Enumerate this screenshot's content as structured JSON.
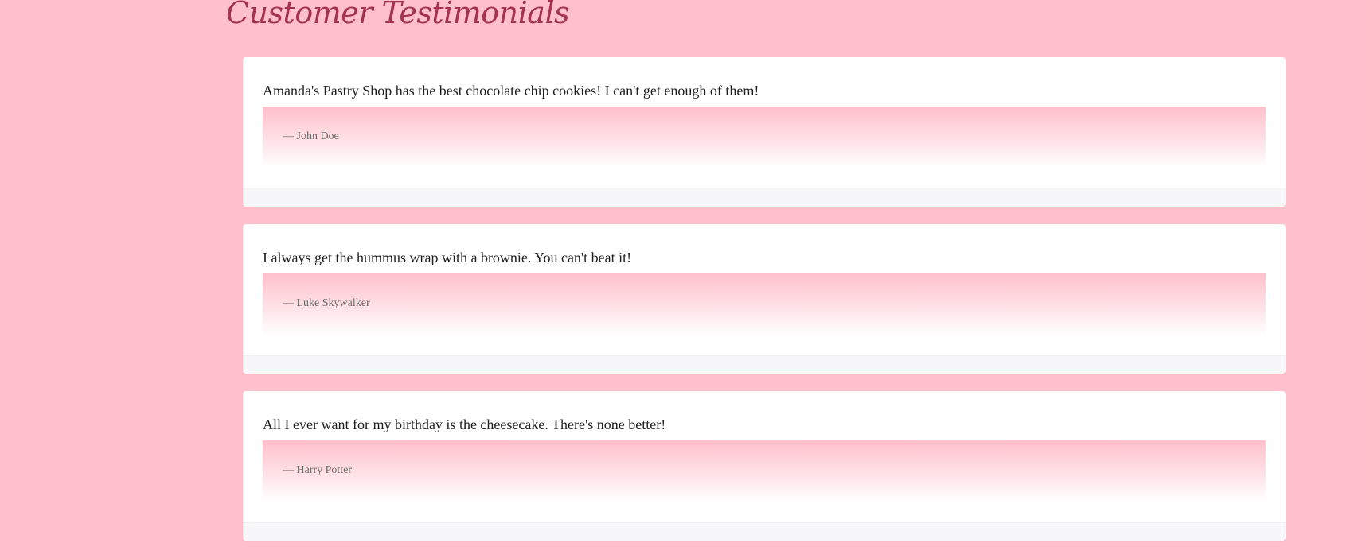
{
  "page": {
    "title": "Customer Testimonials"
  },
  "colors": {
    "background": "#ffc0cb",
    "title": "#a4334f",
    "card": "#ffffff",
    "card_footer": "#f7f7f9",
    "author_text": "#6b6b6b"
  },
  "testimonials": [
    {
      "quote": "Amanda's Pastry Shop has the best chocolate chip cookies! I can't get enough of them!",
      "author": "— John Doe"
    },
    {
      "quote": "I always get the hummus wrap with a brownie. You can't beat it!",
      "author": "— Luke Skywalker"
    },
    {
      "quote": "All I ever want for my birthday is the cheesecake. There's none better!",
      "author": "— Harry Potter"
    }
  ]
}
